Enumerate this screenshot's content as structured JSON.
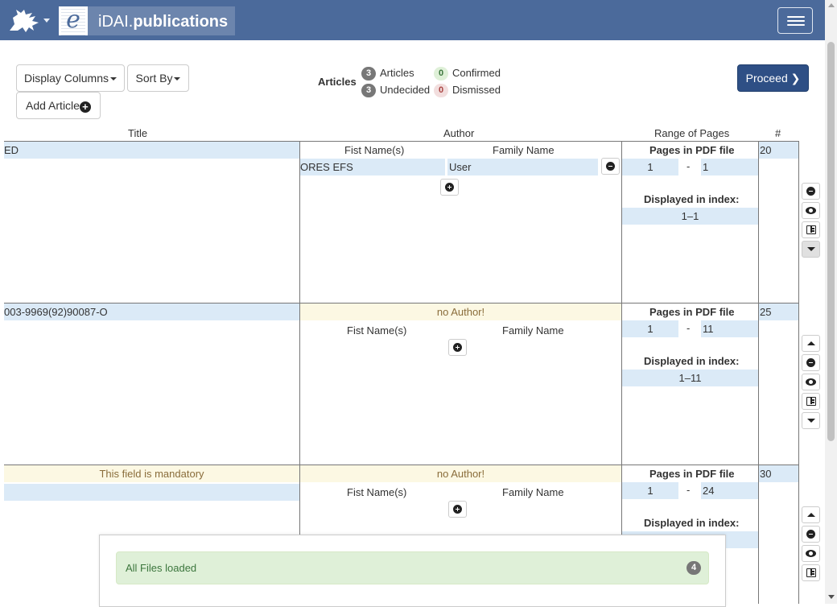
{
  "navbar": {
    "brand_prefix": "iDAI.",
    "brand_name": "publications",
    "logo_letter": "e"
  },
  "toolbar": {
    "display_columns": "Display Columns",
    "sort_by": "Sort By",
    "add_article": "Add Article",
    "add_symbol": "+",
    "proceed": "Proceed",
    "proceed_symbol": "❯"
  },
  "stats": {
    "title": "Articles",
    "articles": {
      "count": "3",
      "label": "Articles"
    },
    "undecided": {
      "count": "3",
      "label": "Undecided"
    },
    "confirmed": {
      "count": "0",
      "label": "Confirmed"
    },
    "dismissed": {
      "count": "0",
      "label": "Dismissed"
    }
  },
  "table": {
    "headers": {
      "title": "Title",
      "author": "Author",
      "pages": "Range of Pages",
      "num": "#"
    },
    "labels": {
      "first_name": "Fist Name(s)",
      "family_name": "Family Name",
      "pages_in_pdf": "Pages in PDF file",
      "displayed_in_index": "Displayed in index:",
      "dash": "-",
      "no_author": "no Author!",
      "mandatory": "This field is mandatory"
    },
    "rows": [
      {
        "title": "ED",
        "author_first": "ORES EFS",
        "author_family": "User",
        "page_from": "1",
        "page_to": "1",
        "displayed": "1–1",
        "num": "20"
      },
      {
        "title": "003-9969(92)90087-O",
        "page_from": "1",
        "page_to": "11",
        "displayed": "1–11",
        "num": "25"
      },
      {
        "title": "",
        "page_from": "1",
        "page_to": "24",
        "num": "30"
      }
    ]
  },
  "panel": {
    "message": "All Files loaded",
    "count": "4"
  },
  "colors": {
    "navbar": "#4b6a9b",
    "proceed": "#2e4f85",
    "field": "#dbeaf7",
    "warning": "#fcf8e3",
    "success": "#dff0d8"
  }
}
